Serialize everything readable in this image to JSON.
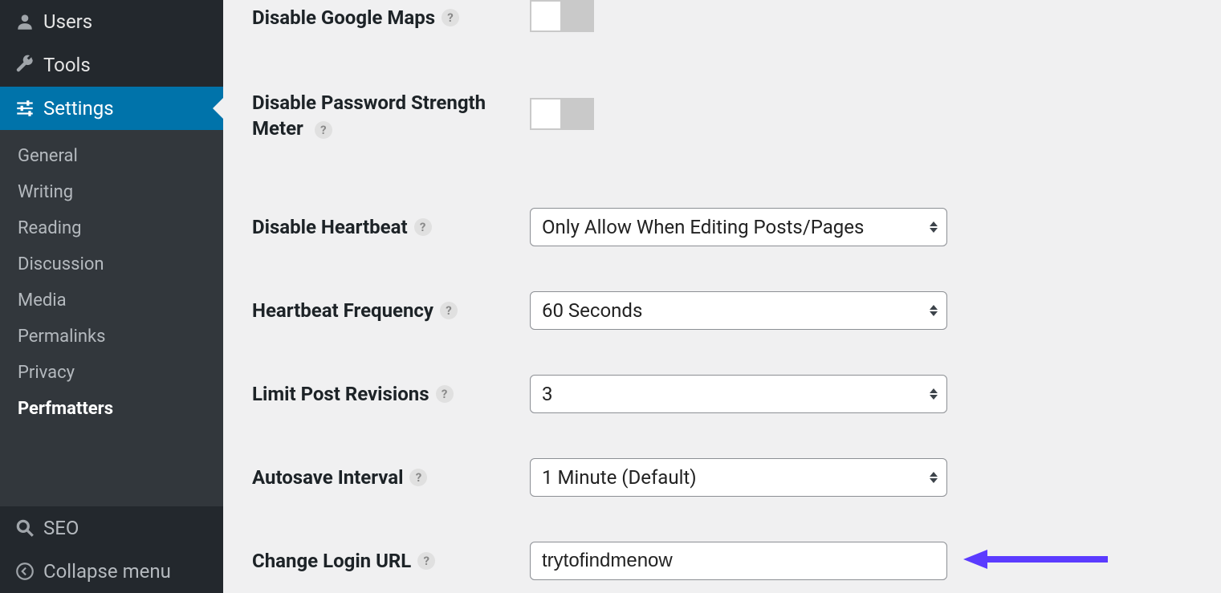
{
  "sidebar": {
    "items": [
      {
        "label": "Users",
        "icon": "users-icon",
        "active": false
      },
      {
        "label": "Tools",
        "icon": "wrench-icon",
        "active": false
      },
      {
        "label": "Settings",
        "icon": "sliders-icon",
        "active": true
      }
    ],
    "sub_items": [
      {
        "label": "General",
        "current": false
      },
      {
        "label": "Writing",
        "current": false
      },
      {
        "label": "Reading",
        "current": false
      },
      {
        "label": "Discussion",
        "current": false
      },
      {
        "label": "Media",
        "current": false
      },
      {
        "label": "Permalinks",
        "current": false
      },
      {
        "label": "Privacy",
        "current": false
      },
      {
        "label": "Perfmatters",
        "current": true
      }
    ],
    "bottom": [
      {
        "label": "SEO",
        "icon": "search-icon"
      },
      {
        "label": "Collapse menu",
        "icon": "collapse-icon"
      }
    ]
  },
  "settings": {
    "gmaps_label": "Disable Google Maps",
    "pwstrength_label_1": "Disable Password Strength",
    "pwstrength_label_2": "Meter",
    "heartbeat_label": "Disable Heartbeat",
    "heartbeat_value": "Only Allow When Editing Posts/Pages",
    "hbfreq_label": "Heartbeat Frequency",
    "hbfreq_value": "60 Seconds",
    "revisions_label": "Limit Post Revisions",
    "revisions_value": "3",
    "autosave_label": "Autosave Interval",
    "autosave_value": "1 Minute (Default)",
    "loginurl_label": "Change Login URL",
    "loginurl_value": "trytofindmenow"
  },
  "help_glyph": "?",
  "annotation_color": "#5b3bff"
}
